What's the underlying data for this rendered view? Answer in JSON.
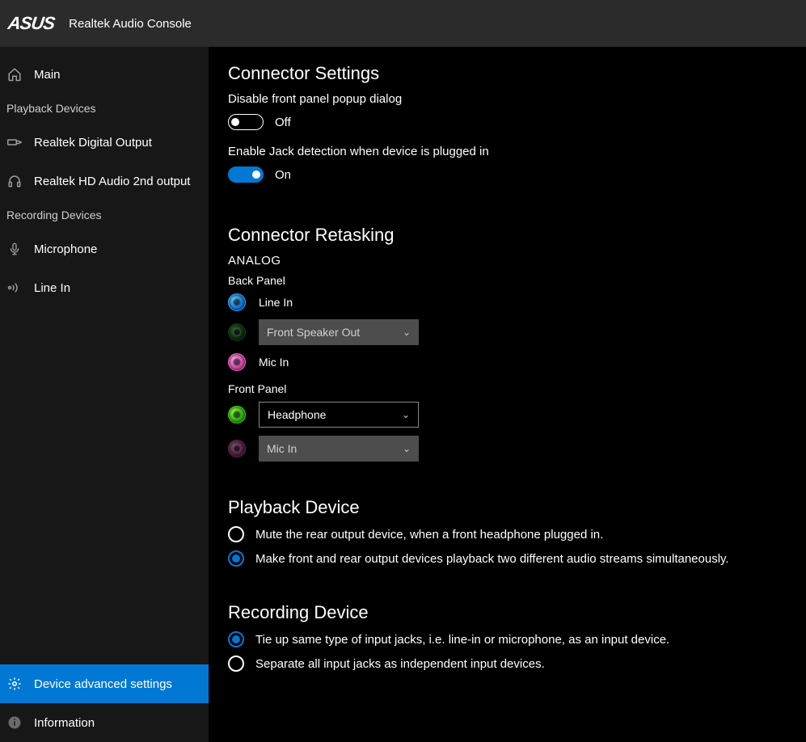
{
  "header": {
    "brand": "ASUS",
    "title": "Realtek Audio Console"
  },
  "sidebar": {
    "main": "Main",
    "playback_header": "Playback Devices",
    "playback": [
      "Realtek Digital Output",
      "Realtek HD Audio 2nd output"
    ],
    "recording_header": "Recording Devices",
    "recording": [
      "Microphone",
      "Line In"
    ],
    "advanced": "Device advanced settings",
    "info": "Information"
  },
  "content": {
    "connector_settings": {
      "title": "Connector Settings",
      "disable_popup_label": "Disable front panel popup dialog",
      "disable_popup_state": "Off",
      "enable_jack_label": "Enable Jack detection when device is plugged in",
      "enable_jack_state": "On"
    },
    "retasking": {
      "title": "Connector Retasking",
      "analog": "ANALOG",
      "back_panel": "Back Panel",
      "back_items": {
        "line_in": "Line In",
        "front_speaker": "Front Speaker Out",
        "mic_in": "Mic In"
      },
      "front_panel": "Front Panel",
      "front_items": {
        "headphone": "Headphone",
        "mic_in": "Mic In"
      }
    },
    "playback_device": {
      "title": "Playback Device",
      "opt1": "Mute the rear output device, when a front headphone plugged in.",
      "opt2": "Make front and rear output devices playback two different audio streams simultaneously."
    },
    "recording_device": {
      "title": "Recording Device",
      "opt1": "Tie up same type of input jacks, i.e. line-in or microphone, as an input device.",
      "opt2": "Separate all input jacks as independent input devices."
    }
  }
}
